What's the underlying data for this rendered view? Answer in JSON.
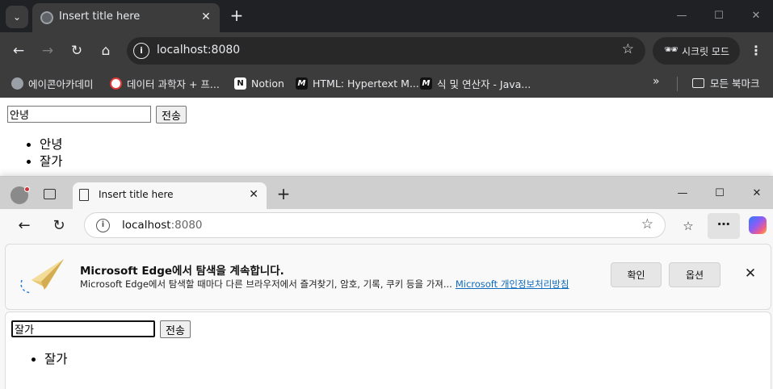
{
  "chrome": {
    "tab_title": "Insert title here",
    "url": "localhost:8080",
    "incognito_label": "시크릿 모드",
    "bookmarks": [
      {
        "label": "에이콘아카데미",
        "icon": "globe-icon"
      },
      {
        "label": "데이터 과학자 + 프...",
        "icon": "red-circle-icon"
      },
      {
        "label": "Notion",
        "icon": "notion-icon",
        "glyph": "N"
      },
      {
        "label": "HTML: Hypertext M...",
        "icon": "mdn-icon",
        "glyph": "M"
      },
      {
        "label": "식 및 연산자 - Java...",
        "icon": "mdn-icon",
        "glyph": "M"
      }
    ],
    "bookmarks_folder": "모든 북마크",
    "page": {
      "input_value": "안녕",
      "submit_label": "전송",
      "list": [
        "안녕",
        "잘가"
      ]
    }
  },
  "edge": {
    "tab_title": "Insert title here",
    "url_host": "localhost",
    "url_port": ":8080",
    "infobar": {
      "title": "Microsoft Edge에서 탐색을 계속합니다.",
      "description": "Microsoft Edge에서 탐색할 때마다 다른 브라우저에서 즐겨찾기, 암호, 기록, 쿠키 등을 가져...",
      "link": "Microsoft 개인정보처리방침",
      "confirm_label": "확인",
      "options_label": "옵션"
    },
    "page": {
      "input_value": "잘가",
      "submit_label": "전송",
      "list": [
        "잘가"
      ]
    }
  },
  "colors": {
    "chrome_dark": "#202124",
    "chrome_toolbar": "#3c3c3c",
    "edge_link": "#0f6cbd",
    "edge_tabstrip": "#cfcfcf"
  }
}
